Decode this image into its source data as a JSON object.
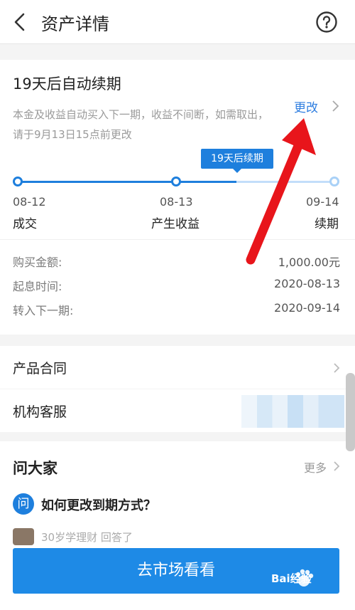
{
  "header": {
    "title": "资产详情"
  },
  "renewal": {
    "title": "19天后自动续期",
    "description": "本金及收益自动买入下一期，收益不间断，如需取出，请于9月13日15点前更改",
    "change_label": "更改",
    "badge": "19天后续期"
  },
  "timeline": [
    {
      "date": "08-12",
      "label": "成交"
    },
    {
      "date": "08-13",
      "label": "产生收益"
    },
    {
      "date": "09-14",
      "label": "续期"
    }
  ],
  "details": [
    {
      "label": "购买金额:",
      "value": "1,000.00元"
    },
    {
      "label": "起息时间:",
      "value": "2020-08-13"
    },
    {
      "label": "转入下一期:",
      "value": "2020-09-14"
    }
  ],
  "menu": {
    "contract": "产品合同",
    "service": "机构客服"
  },
  "ask": {
    "title": "问大家",
    "more": "更多",
    "question_icon": "问",
    "question": "如何更改到期方式？",
    "answer_preview": "30岁学理财 回答了"
  },
  "cta": {
    "label": "去市场看看"
  },
  "watermark": "Bai经验",
  "colors": {
    "accent": "#1e7fdd",
    "annotation_arrow": "#e8151b"
  },
  "icons": {
    "back": "back-chevron-icon",
    "help": "question-circle-icon",
    "chevron": "chevron-right-icon"
  },
  "progress": {
    "completed_fraction": 0.68
  }
}
